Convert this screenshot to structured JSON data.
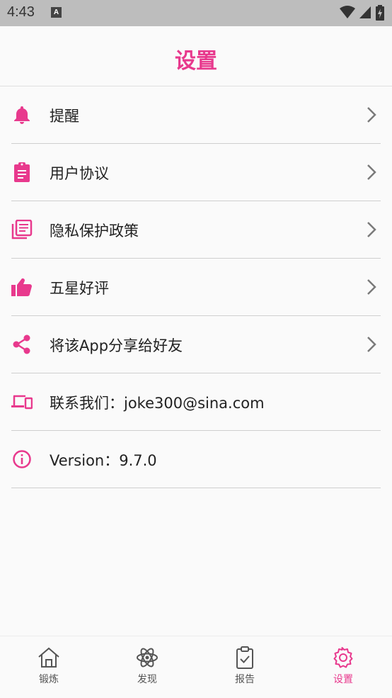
{
  "status_bar": {
    "time": "4:43",
    "notification_badge": "A"
  },
  "header": {
    "title": "设置"
  },
  "menu": {
    "items": [
      {
        "label": "提醒",
        "icon": "bell-icon",
        "has_chevron": true
      },
      {
        "label": "用户协议",
        "icon": "clipboard-icon",
        "has_chevron": true
      },
      {
        "label": "隐私保护政策",
        "icon": "document-stack-icon",
        "has_chevron": true
      },
      {
        "label": "五星好评",
        "icon": "thumbs-up-icon",
        "has_chevron": true
      },
      {
        "label": "将该App分享给好友",
        "icon": "share-icon",
        "has_chevron": true
      },
      {
        "label": "联系我们：joke300@sina.com",
        "icon": "devices-icon",
        "has_chevron": false
      },
      {
        "label": "Version：9.7.0",
        "icon": "info-icon",
        "has_chevron": false
      }
    ]
  },
  "bottom_nav": {
    "items": [
      {
        "label": "锻炼",
        "icon": "home-icon",
        "active": false
      },
      {
        "label": "发现",
        "icon": "atom-icon",
        "active": false
      },
      {
        "label": "报告",
        "icon": "clipboard-check-icon",
        "active": false
      },
      {
        "label": "设置",
        "icon": "settings-gear-icon",
        "active": true
      }
    ]
  },
  "colors": {
    "accent": "#e8398d",
    "text": "#222222",
    "divider": "#cfcfcf",
    "status_bar": "#bdbdbd"
  }
}
